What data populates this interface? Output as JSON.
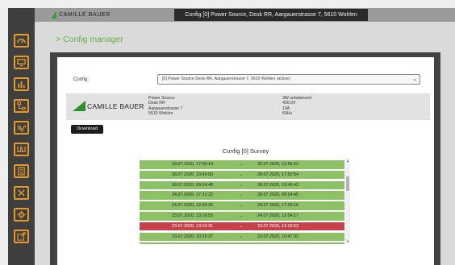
{
  "colors": {
    "accent": "#e79a2a",
    "brand_green": "#62b24a",
    "row_ok": "#8cc265",
    "row_alert": "#c7414c",
    "sidebar_bg": "#3f3f3f"
  },
  "header": {
    "logo_text": "CAMILLE BAUER",
    "title": "Config [0] Power Source, Desk RR, Aargauerstrasse 7, 5610 Wohlen"
  },
  "sidebar": {
    "icons": [
      "dashboard-icon",
      "display-icon",
      "bar-chart-icon",
      "network-icon",
      "harmonics-icon",
      "waveform-icon",
      "document-icon",
      "tools-icon",
      "settings-gear-icon",
      "export-icon"
    ]
  },
  "page": {
    "title": "> Config manager"
  },
  "config": {
    "label": "Config:",
    "selected": "[0] Power Source Desk RR, Aargauerstrasse 7, 5610 Wohlen (active)"
  },
  "device": {
    "logo_text": "CAMILLE BAUER",
    "site_lines": [
      "Power Source",
      "Desk RR",
      "Aargauerstrasse 7",
      "5610 Wohlen"
    ],
    "tech_lines": [
      "3W unbalanced",
      "400.0V",
      "10A",
      "50Hz"
    ]
  },
  "download_label": "Download",
  "survey": {
    "title": "Config [0] Survey",
    "arrow": "→",
    "rows": [
      {
        "start": "28.07.2020, 17:55:19",
        "end": "30.07.2020, 12:59:22",
        "status": "ok"
      },
      {
        "start": "28.07.2020, 13:49:50",
        "end": "28.07.2020, 17:52:54",
        "status": "ok"
      },
      {
        "start": "28.07.2020, 09:24:48",
        "end": "28.07.2020, 13:49:42",
        "status": "ok"
      },
      {
        "start": "24.07.2020, 17:31:22",
        "end": "28.07.2020, 09:24:45",
        "status": "ok"
      },
      {
        "start": "24.07.2020, 12:55:26",
        "end": "24.07.2020, 17:30:16",
        "status": "ok"
      },
      {
        "start": "23.07.2020, 13:10:55",
        "end": "24.07.2020, 12:54:17",
        "status": "ok"
      },
      {
        "start": "23.07.2020, 13:10:31",
        "end": "23.07.2020, 13:10:53",
        "status": "alert"
      },
      {
        "start": "23.07.2020, 10:25:37",
        "end": "23.07.2020, 10:47:32",
        "status": "ok"
      },
      {
        "start": "23.07.2020, 10:14:53",
        "end": "23.07.2020, 10:25:21",
        "status": "ok"
      }
    ]
  }
}
